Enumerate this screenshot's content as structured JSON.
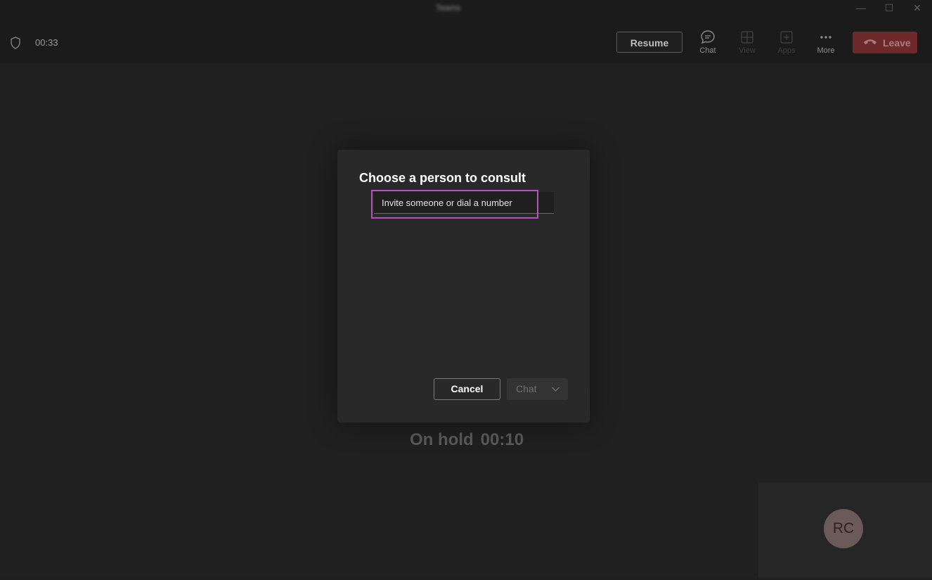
{
  "window": {
    "title": "Teams",
    "minimize_glyph": "—",
    "maximize_glyph": "☐",
    "close_glyph": "✕"
  },
  "toolbar": {
    "call_timer": "00:33",
    "resume_label": "Resume",
    "tools": [
      {
        "label": "Chat",
        "icon": "chat-bubble-icon",
        "enabled": true
      },
      {
        "label": "View",
        "icon": "grid-view-icon",
        "enabled": false
      },
      {
        "label": "Apps",
        "icon": "add-app-icon",
        "enabled": false
      },
      {
        "label": "More",
        "icon": "ellipsis-icon",
        "enabled": true
      }
    ],
    "leave_label": "Leave"
  },
  "dialog": {
    "title": "Choose a person to consult",
    "invite_placeholder": "Invite someone or dial a number",
    "cancel_label": "Cancel",
    "chat_label": "Chat"
  },
  "stage": {
    "hold_label": "On hold",
    "hold_timer": "00:10",
    "self_initials": "RC"
  },
  "colors": {
    "leave_red": "#6e2a2b",
    "highlight_purple": "#b453b8",
    "background": "#202020"
  }
}
